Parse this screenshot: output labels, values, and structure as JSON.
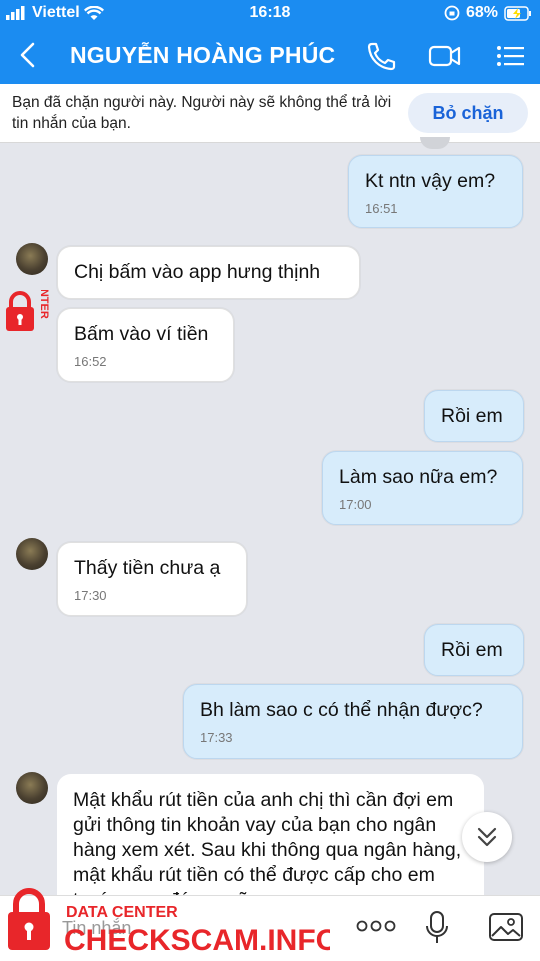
{
  "status_bar": {
    "carrier": "Viettel",
    "time": "16:18",
    "battery": "68%"
  },
  "header": {
    "title": "NGUYỄN HOÀNG PHÚC"
  },
  "banner": {
    "text": "Bạn đã chặn người này. Người này sẽ không thể trả lời tin nhắn của bạn.",
    "button": "Bỏ chặn"
  },
  "messages": [
    {
      "dir": "out",
      "text": "Kt ntn vậy em?",
      "time": "16:51"
    },
    {
      "dir": "in",
      "text": "Chị bấm vào app hưng thịnh",
      "time": ""
    },
    {
      "dir": "in",
      "text": "Bấm vào ví tiền",
      "time": "16:52"
    },
    {
      "dir": "out",
      "text": "Rồi em",
      "time": ""
    },
    {
      "dir": "out",
      "text": "Làm sao nữa em?",
      "time": "17:00"
    },
    {
      "dir": "in",
      "text": "Thấy tiền chưa ạ",
      "time": "17:30"
    },
    {
      "dir": "out",
      "text": "Rồi em",
      "time": ""
    },
    {
      "dir": "out",
      "text": "Bh làm sao c có thể nhận được?",
      "time": "17:33"
    },
    {
      "dir": "in",
      "text": "Mật khẩu rút tiền của anh chị thì cần đợi em gửi thông tin khoản vay của bạn cho ngân hàng  xem xét. Sau khi thông qua ngân hàng, mật khẩu rút tiền có thể được cấp cho em trước, sau đó em sẽ",
      "time": ""
    }
  ],
  "composer": {
    "placeholder": "Tin nhắn"
  },
  "watermark": {
    "line1": "DATA CENTER",
    "line2": "CHECKSCAM.INFO"
  }
}
